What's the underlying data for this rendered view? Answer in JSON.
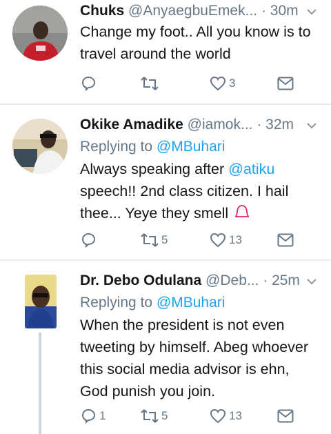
{
  "tweets": [
    {
      "name": "Chuks",
      "handle": "@AnyaegbuEmek...",
      "sep": " · ",
      "time": "30m",
      "replying_label": "",
      "replying_to": "",
      "body": "Change my foot.. All you know is to travel around the world",
      "reply_count": "",
      "retweet_count": "",
      "like_count": "3"
    },
    {
      "name": "Okike Amadike",
      "handle": "@iamok...",
      "sep": " · ",
      "time": "32m",
      "replying_label": "Replying to",
      "replying_to": "@MBuhari",
      "body_pre": "Always speaking after ",
      "body_mention": "@atiku",
      "body_post": " speech!!  2nd class citizen. I hail thee...  Yeye they smell",
      "reply_count": "",
      "retweet_count": "5",
      "like_count": "13"
    },
    {
      "name": "Dr. Debo Odulana",
      "handle": "@Deb...",
      "sep": " · ",
      "time": "25m",
      "replying_label": "Replying to",
      "replying_to": "@MBuhari",
      "body": "When the president is not even tweeting by himself. Abeg whoever this social media advisor is ehn, God punish you join.",
      "reply_count": "1",
      "retweet_count": "5",
      "like_count": "13"
    }
  ],
  "icons": [
    "reply-icon",
    "retweet-icon",
    "like-icon",
    "message-icon",
    "chevron-down-icon",
    "bell-icon"
  ],
  "colors": {
    "link": "#1da1f2",
    "muted": "#657786",
    "text": "#14171a",
    "divider": "#e6ecf0",
    "bell": "#e0245e"
  }
}
